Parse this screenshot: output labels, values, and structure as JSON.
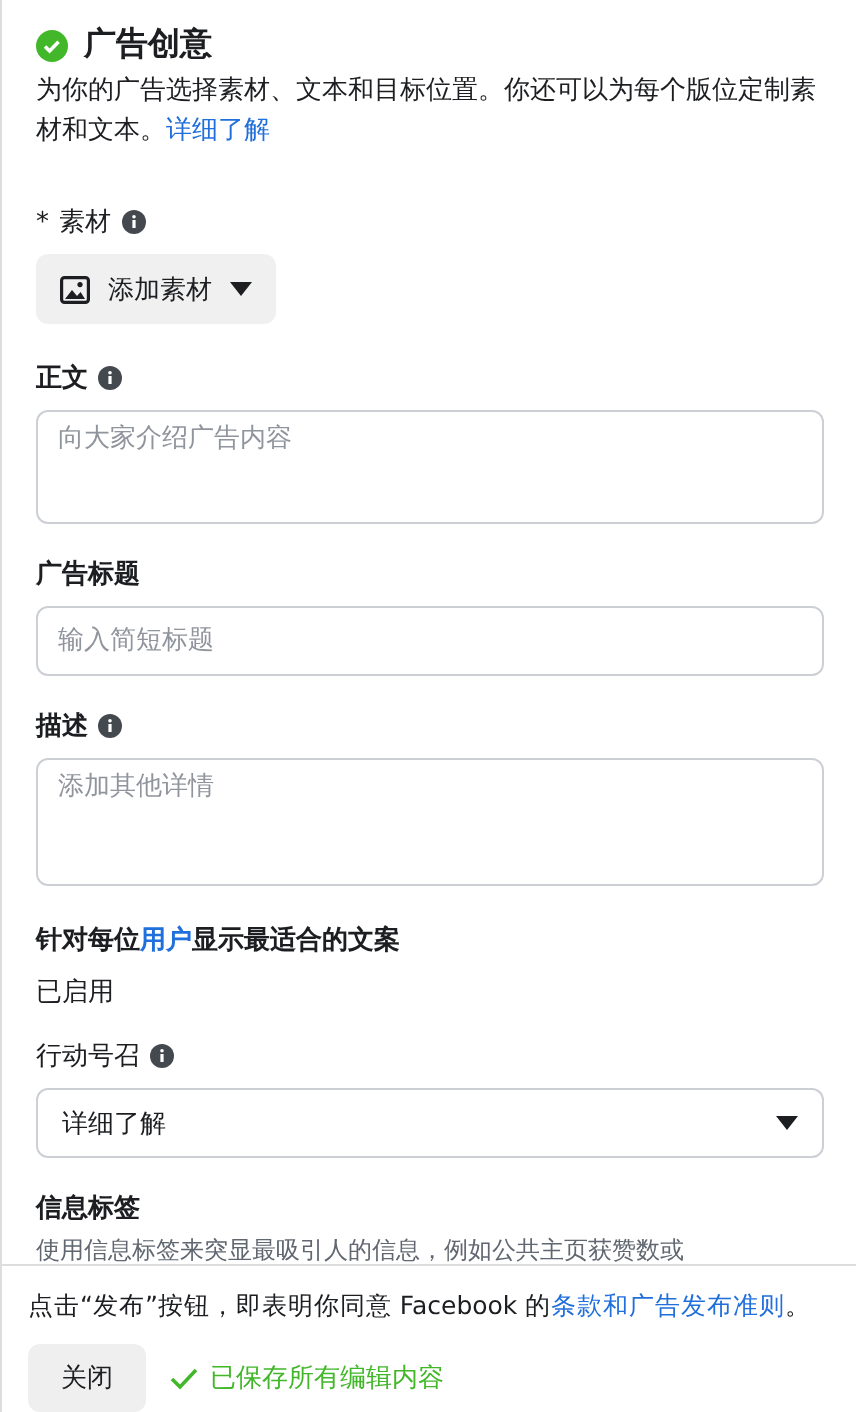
{
  "section": {
    "title": "广告创意",
    "complete": true,
    "description": "为你的广告选择素材、文本和目标位置。你还可以为每个版位定制素材和文本。",
    "learn_more": "详细了解"
  },
  "media": {
    "label": "素材",
    "required_mark": "*",
    "button": "添加素材"
  },
  "fields": [
    {
      "kind": "textarea",
      "label": "正文",
      "info": true,
      "placeholder": "向大家介绍广告内容"
    },
    {
      "kind": "input",
      "label": "广告标题",
      "info": false,
      "placeholder": "输入简短标题"
    },
    {
      "kind": "textarea",
      "label": "描述",
      "info": true,
      "placeholder": "添加其他详情"
    }
  ],
  "optimization": {
    "label": "针对每位**用户**显示最适合的文案",
    "status": "已启用"
  },
  "call_to_action": {
    "label": "行动号召",
    "info": true,
    "value": "详细了解"
  },
  "info_labels": {
    "label": "信息标签",
    "description": "使用信息标签来突显最吸引人的信息，例如公共主页获赞数或"
  },
  "footer": {
    "notice": "点击“发布”按钮，即表明你同意 Facebook 的",
    "terms_link": "条款和广告发布准则",
    "notice_end": "。",
    "close_button": "关闭",
    "save_status": "已保存所有编辑内容",
    "saved": true
  }
}
